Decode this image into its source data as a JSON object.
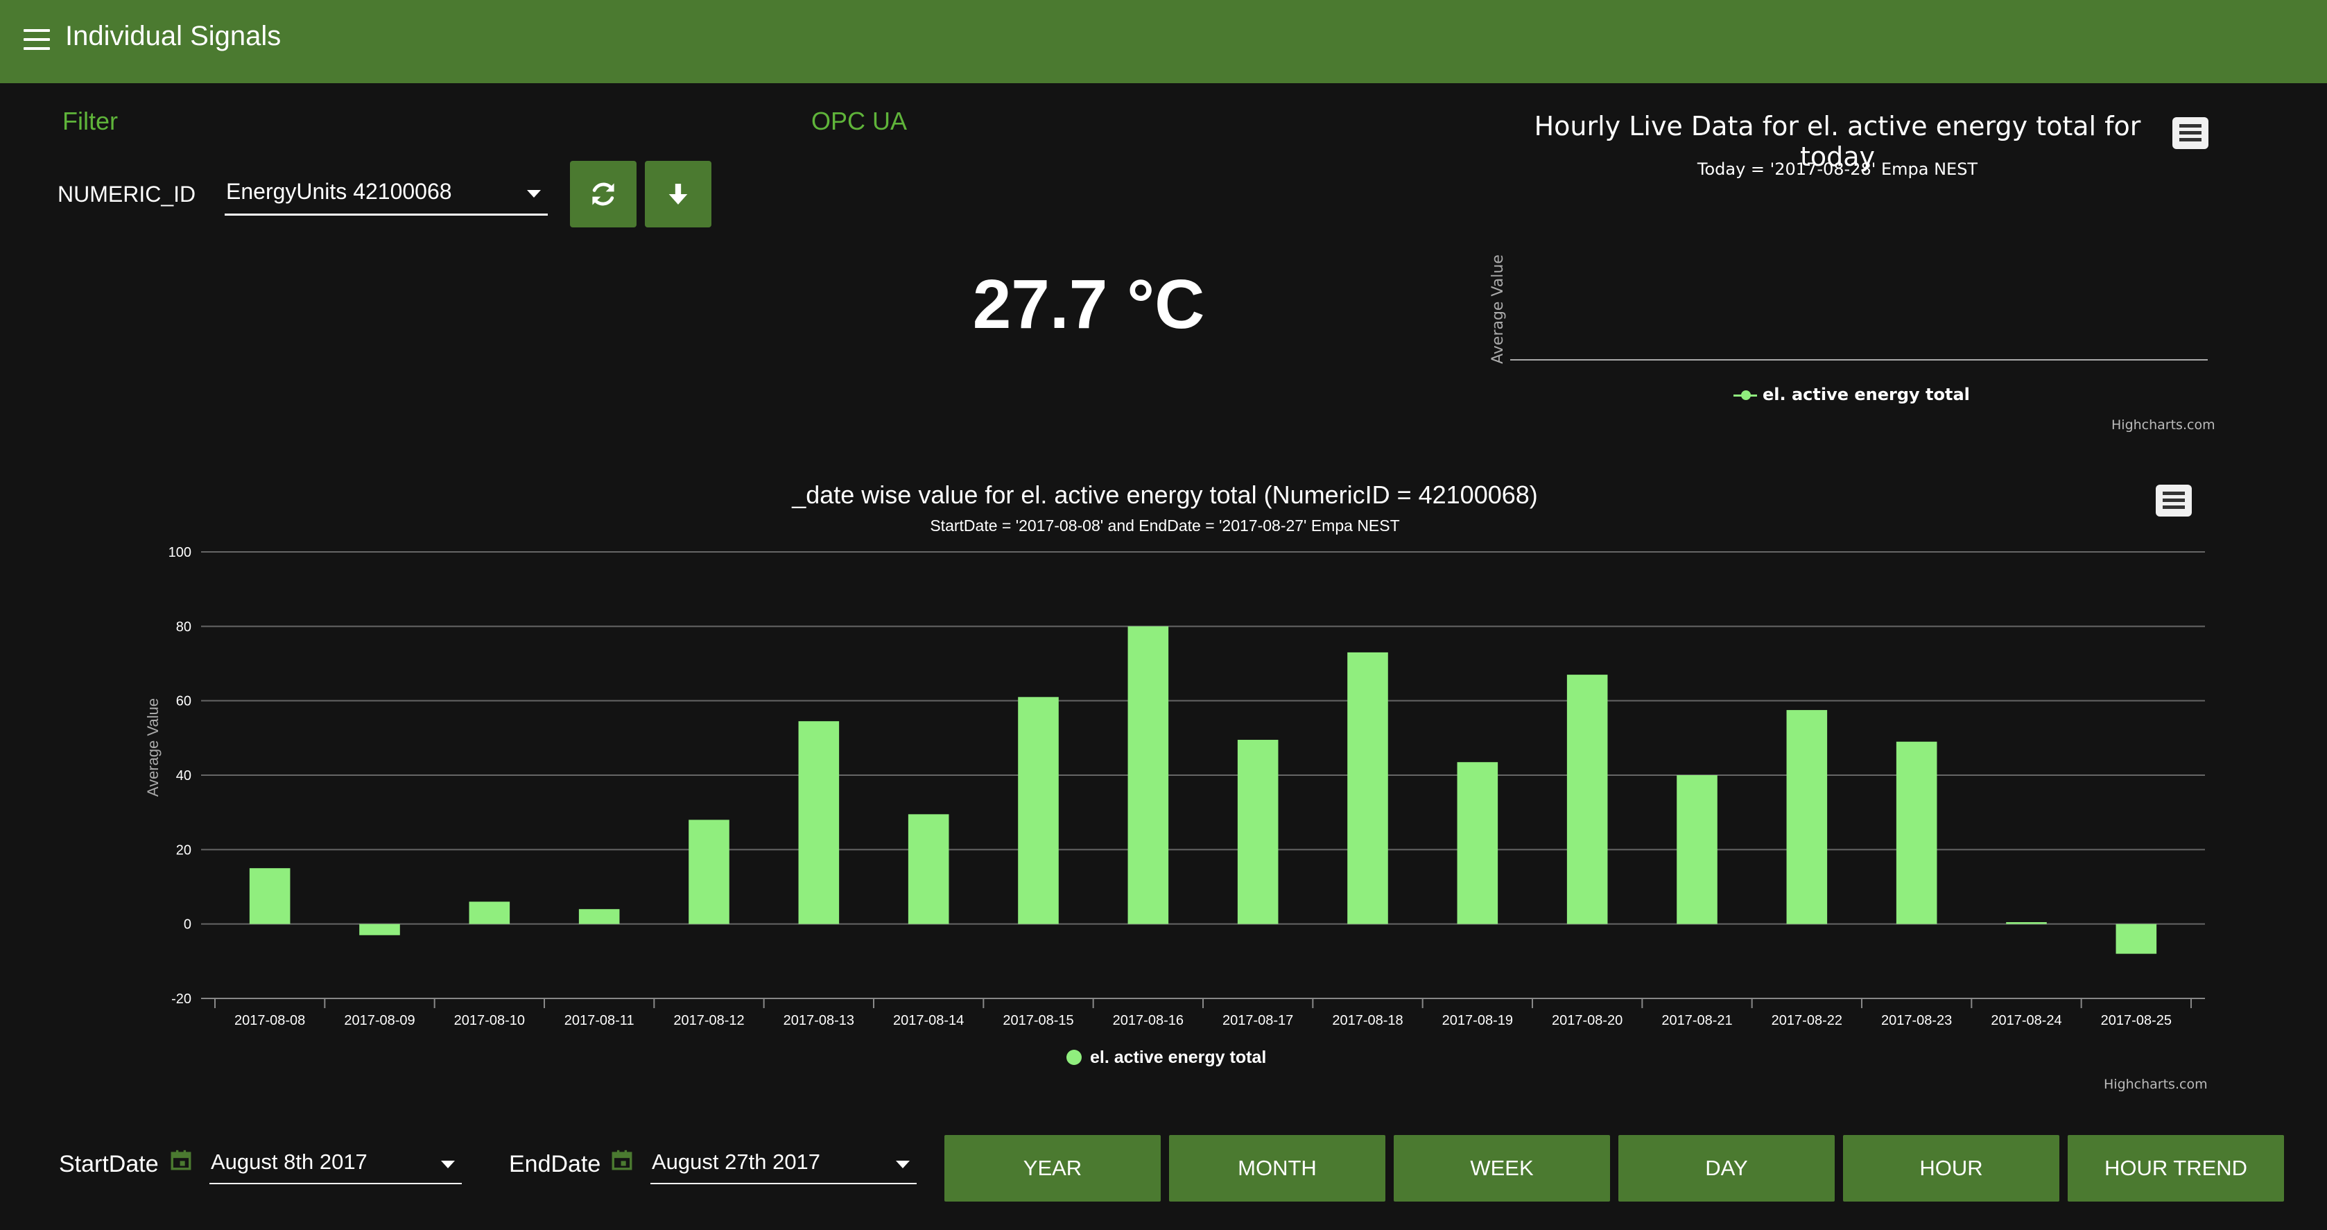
{
  "header": {
    "title": "Individual Signals"
  },
  "filter": {
    "title": "Filter",
    "numeric_label": "NUMERIC_ID",
    "selected": "EnergyUnits 42100068"
  },
  "opc": {
    "title": "OPC UA",
    "value": "27.7 °C"
  },
  "hourly_chart": {
    "title": "Hourly Live Data for el. active energy total for today",
    "subtitle": "Today = '2017-08-28' Empa NEST",
    "ylabel": "Average Value",
    "legend": "el. active energy total",
    "credits": "Highcharts.com"
  },
  "main_chart": {
    "title": "_date wise value for el. active energy total (NumericID = 42100068)",
    "subtitle": "StartDate = '2017-08-08' and EndDate = '2017-08-27' Empa NEST",
    "legend": "el. active energy total",
    "credits": "Highcharts.com"
  },
  "chart_data": {
    "type": "bar",
    "title": "_date wise value for el. active energy total (NumericID = 42100068)",
    "subtitle": "StartDate = '2017-08-08' and EndDate = '2017-08-27' Empa NEST",
    "xlabel": "",
    "ylabel": "Average Value",
    "ylim": [
      -20,
      100
    ],
    "yticks": [
      -20,
      0,
      20,
      40,
      60,
      80,
      100
    ],
    "grid": true,
    "legend_position": "bottom",
    "categories": [
      "2017-08-08",
      "2017-08-09",
      "2017-08-10",
      "2017-08-11",
      "2017-08-12",
      "2017-08-13",
      "2017-08-14",
      "2017-08-15",
      "2017-08-16",
      "2017-08-17",
      "2017-08-18",
      "2017-08-19",
      "2017-08-20",
      "2017-08-21",
      "2017-08-22",
      "2017-08-23",
      "2017-08-24",
      "2017-08-25"
    ],
    "series": [
      {
        "name": "el. active energy total",
        "color": "#90ee7e",
        "values": [
          15,
          -3,
          6,
          4,
          28,
          54.5,
          29.5,
          61,
          80,
          49.5,
          73,
          43.5,
          67,
          40,
          57.5,
          49,
          0.5,
          -8
        ]
      }
    ]
  },
  "dates": {
    "start_label": "StartDate",
    "start_value": "August 8th 2017",
    "end_label": "EndDate",
    "end_value": "August 27th 2017"
  },
  "ranges": [
    "YEAR",
    "MONTH",
    "WEEK",
    "DAY",
    "HOUR",
    "HOUR TREND"
  ],
  "colors": {
    "accent": "#4b7a30",
    "bar": "#90ee7e",
    "label_green": "#5fb43a",
    "background": "#131313"
  }
}
